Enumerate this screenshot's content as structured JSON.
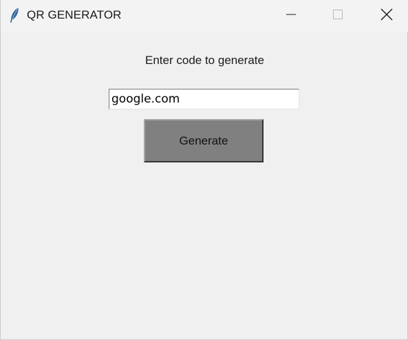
{
  "window": {
    "title": "QR GENERATOR",
    "app_icon": "feather-icon",
    "controls": {
      "minimize": "minimize-icon",
      "maximize": "maximize-icon",
      "close": "close-icon"
    }
  },
  "main": {
    "prompt_label": "Enter code to generate",
    "code_input": {
      "value": "google.com"
    },
    "generate_button": {
      "label": "Generate"
    }
  },
  "colors": {
    "window_bg": "#f0f0f0",
    "titlebar_bg": "#f3f3f3",
    "button_bg": "#808080",
    "entry_bg": "#ffffff"
  }
}
